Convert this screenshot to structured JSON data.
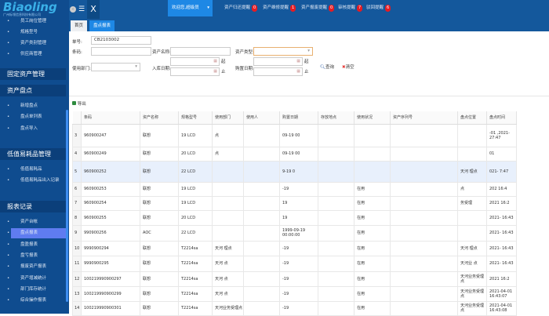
{
  "brand": {
    "name": "Biaoling",
    "company": "广州标领信息科技有限公司"
  },
  "topbar": {
    "menu_icon": "hamburger-icon",
    "close_icon": "x-icon",
    "welcome": "欢迎您,超级员",
    "alerts": [
      {
        "label": "资产归还提醒",
        "count": "0"
      },
      {
        "label": "资产维修提醒",
        "count": "1"
      },
      {
        "label": "资产报废提醒",
        "count": "0"
      },
      {
        "label": "审核提醒",
        "count": "7"
      },
      {
        "label": "驳回提醒",
        "count": "6"
      }
    ]
  },
  "tabs": [
    {
      "label": "首页"
    },
    {
      "label": "盘点报表"
    }
  ],
  "sidebar": {
    "top_items": [
      "员工岗位管理",
      "规格型号",
      "资产类别管理",
      "供应商管理"
    ],
    "sections": [
      {
        "title": "固定资产管理",
        "items": []
      },
      {
        "title": "资产盘点",
        "items": [
          "新增盘点",
          "盘点单列表",
          "盘点导入"
        ]
      },
      {
        "title": "低值易耗品管理",
        "items": [
          "低值易耗品",
          "低值易耗品出入记录"
        ]
      },
      {
        "title": "报表记录",
        "items": [
          "资产台帐",
          "盘点报表",
          "盘盈报表",
          "盘亏报表",
          "报废资产报表",
          "资产增减统计",
          "部门库存统计",
          "综合操作报表"
        ]
      }
    ],
    "active": "盘点报表"
  },
  "form": {
    "order_no_label": "单号:",
    "order_no": "CB2103002",
    "barcode_label": "条码:",
    "asset_name_label": "资产名称:",
    "asset_type_label": "资产类型:",
    "dept_label": "使用部门:",
    "in_date_label": "入库日期:",
    "purchase_date_label": "购置日期:",
    "from": "起",
    "to": "止",
    "search": "查询",
    "clear": "清空"
  },
  "toolbar": {
    "export": "导出"
  },
  "table": {
    "columns": [
      "条码",
      "资产名称",
      "规格型号",
      "使用部门",
      "使用人",
      "购置日期",
      "存放地点",
      "使用状况",
      "资产序列号",
      "盘点位置",
      "盘点时间"
    ],
    "rows": [
      {
        "idx": "3",
        "code": "960900247",
        "name": "联想",
        "model": "19 LCD",
        "dept": "点",
        "date": "09-19 00",
        "status": "",
        "loc": "",
        "time": "-01 ,2021- 27:47"
      },
      {
        "idx": "4",
        "code": "960900249",
        "name": "联想",
        "model": "20 LCD",
        "dept": "点",
        "date": "09-19 00",
        "status": "",
        "loc": "",
        "time": "01"
      },
      {
        "idx": "5",
        "code": "960900252",
        "name": "联想",
        "model": "22 LCD",
        "dept": "",
        "date": "9-19 0",
        "status": "",
        "loc": "天河 理点",
        "time": "021- 7:47"
      },
      {
        "idx": "6",
        "code": "960900253",
        "name": "联想",
        "model": "19 LCD",
        "dept": "",
        "date": "-19",
        "status": "在用",
        "loc": "点",
        "time": "202 16:4"
      },
      {
        "idx": "7",
        "code": "960900254",
        "name": "联想",
        "model": "19 LCD",
        "dept": "",
        "date": "19",
        "status": "在用",
        "loc": "务受理",
        "time": "2021 16:2"
      },
      {
        "idx": "8",
        "code": "960900255",
        "name": "联想",
        "model": "20 LCD",
        "dept": "",
        "date": "19",
        "status": "在用",
        "loc": "",
        "time": "2021- 16:43"
      },
      {
        "idx": "9",
        "code": "990900256",
        "name": "AOC",
        "model": "22 LCD",
        "dept": "",
        "date": "1999-09-19 00:00:00",
        "status": "在用",
        "loc": "",
        "time": "2021- 16:43"
      },
      {
        "idx": "10",
        "code": "9990900294",
        "name": "联想",
        "model": "T2214sa",
        "dept": "天河 理点",
        "date": "-19",
        "status": "在用",
        "loc": "天河 理点",
        "time": "2021- 16:43"
      },
      {
        "idx": "11",
        "code": "9990900295",
        "name": "联想",
        "model": "T2214sa",
        "dept": "天河 点",
        "date": "-19",
        "status": "在用",
        "loc": "天河业 点",
        "time": "2021- 16:43"
      },
      {
        "idx": "12",
        "code": "100219990900297",
        "name": "联想",
        "model": "T2214sa",
        "dept": "天河 点",
        "date": "-19",
        "status": "在用",
        "loc": "天河业务受理点",
        "time": "2021 16:2"
      },
      {
        "idx": "13",
        "code": "100219990900299",
        "name": "联想",
        "model": "T2214sa",
        "dept": "天河 点",
        "date": "-19",
        "status": "在用",
        "loc": "天河业务受理点",
        "time": "2021-04-01 16:43:07"
      },
      {
        "idx": "14",
        "code": "100219990900301",
        "name": "联想",
        "model": "T2214sa",
        "dept": "天河业务受理点",
        "date": "-19",
        "status": "在用",
        "loc": "天河业务受理点",
        "time": "2021-04-01 16:43:08"
      }
    ]
  },
  "colors": {
    "sidebar": "#0f4c8f",
    "topbar": "#14589c",
    "accent": "#1e88e5",
    "active_item": "#5f7cf0",
    "badge": "#e51c23"
  }
}
